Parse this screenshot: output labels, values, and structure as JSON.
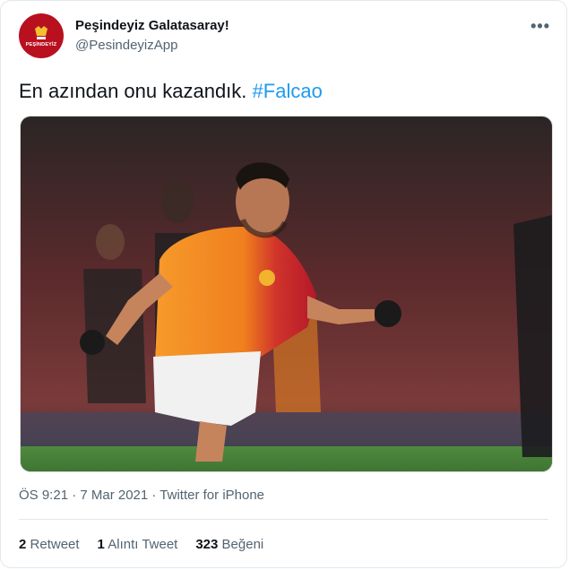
{
  "tweet": {
    "author_name": "Peşindeyiz Galatasaray!",
    "handle": "@PesindeyizApp",
    "avatar_text": "PEŞİNDEYİZ",
    "more_label": "•••",
    "text_main": "En azından onu kazandık. ",
    "hashtag": "#Falcao",
    "meta": "ÖS 9:21 · 7 Mar 2021 · Twitter for iPhone",
    "stats": {
      "retweet_count": "2",
      "retweet_label": "Retweet",
      "quote_count": "1",
      "quote_label": "Alıntı Tweet",
      "like_count": "323",
      "like_label": "Beğeni"
    }
  },
  "colors": {
    "accent": "#1d9bf0",
    "avatar": "#b8101f",
    "jersey_orange": "#f2851e",
    "jersey_red": "#c8102e"
  }
}
